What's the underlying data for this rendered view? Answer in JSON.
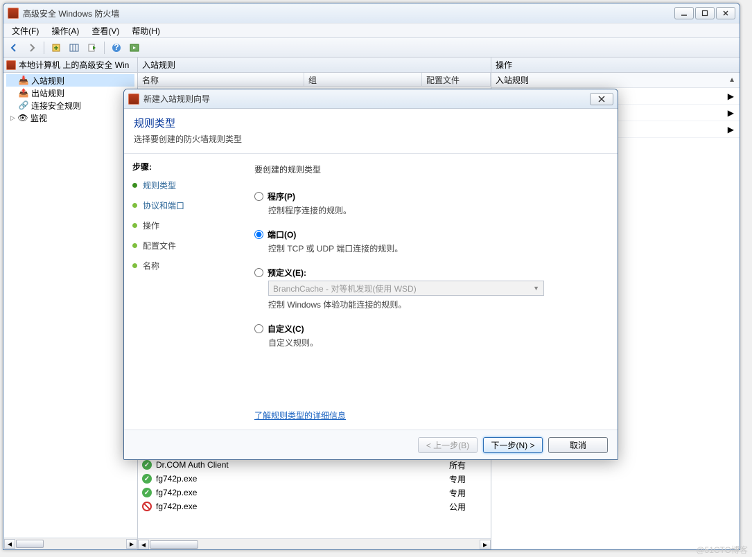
{
  "main_window": {
    "title": "高级安全 Windows 防火墙",
    "menu": [
      "文件(F)",
      "操作(A)",
      "查看(V)",
      "帮助(H)"
    ],
    "tree_root": "本地计算机 上的高级安全 Win",
    "tree": [
      {
        "label": "入站规则",
        "selected": true
      },
      {
        "label": "出站规则"
      },
      {
        "label": "连接安全规则"
      },
      {
        "label": "监视",
        "expandable": true
      }
    ],
    "center_header": "入站规则",
    "columns": {
      "name": "名称",
      "group": "组",
      "profile": "配置文件"
    },
    "rows": [
      {
        "name": "Dr.COM Auth Client",
        "scope": "所有",
        "status": "ok"
      },
      {
        "name": "fg742p.exe",
        "scope": "专用",
        "status": "ok"
      },
      {
        "name": "fg742p.exe",
        "scope": "专用",
        "status": "ok"
      },
      {
        "name": "fg742p.exe",
        "scope": "公用",
        "status": "block"
      }
    ],
    "actions_header": "操作",
    "actions_section": "入站规则"
  },
  "wizard": {
    "title": "新建入站规则向导",
    "heading": "规则类型",
    "subheading": "选择要创建的防火墙规则类型",
    "steps_label": "步骤:",
    "steps": [
      {
        "label": "规则类型",
        "active": true,
        "link": true
      },
      {
        "label": "协议和端口",
        "link": true
      },
      {
        "label": "操作"
      },
      {
        "label": "配置文件"
      },
      {
        "label": "名称"
      }
    ],
    "question": "要创建的规则类型",
    "options": [
      {
        "key": "program",
        "title": "程序(P)",
        "desc": "控制程序连接的规则。",
        "checked": false
      },
      {
        "key": "port",
        "title": "端口(O)",
        "desc": "控制 TCP 或 UDP 端口连接的规则。",
        "checked": true
      },
      {
        "key": "predefined",
        "title": "预定义(E):",
        "desc": "控制 Windows 体验功能连接的规则。",
        "checked": false,
        "dropdown": "BranchCache - 对等机发现(使用 WSD)"
      },
      {
        "key": "custom",
        "title": "自定义(C)",
        "desc": "自定义规则。",
        "checked": false
      }
    ],
    "learn_more": "了解规则类型的详细信息",
    "buttons": {
      "back": "< 上一步(B)",
      "next": "下一步(N) >",
      "cancel": "取消"
    }
  },
  "watermark": "@51CTO博客"
}
